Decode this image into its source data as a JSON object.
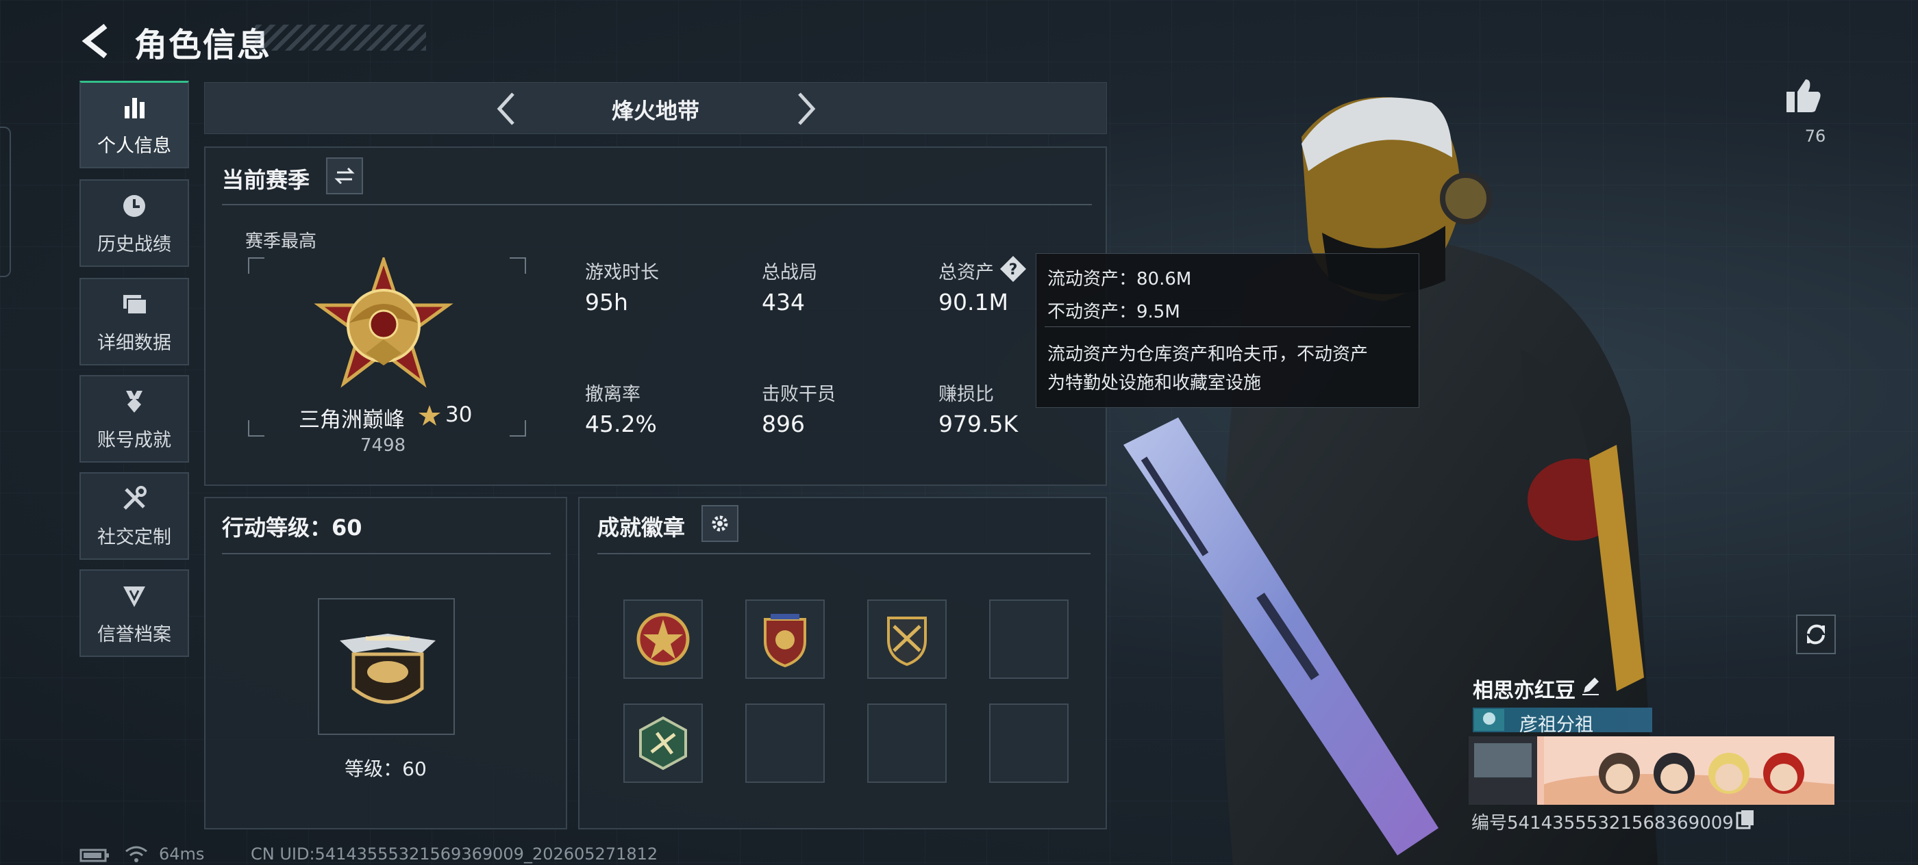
{
  "header": {
    "title": "角色信息"
  },
  "sidebar": {
    "items": [
      {
        "label": "个人信息",
        "icon": "bar-chart-icon",
        "active": true
      },
      {
        "label": "历史战绩",
        "icon": "history-clock-icon",
        "active": false
      },
      {
        "label": "详细数据",
        "icon": "folder-icon",
        "active": false
      },
      {
        "label": "账号成就",
        "icon": "achievement-icon",
        "active": false
      },
      {
        "label": "社交定制",
        "icon": "tools-icon",
        "active": false
      },
      {
        "label": "信誉档案",
        "icon": "shield-icon",
        "active": false
      }
    ]
  },
  "mode_selector": {
    "title": "烽火地带"
  },
  "season": {
    "title": "当前赛季",
    "best_label": "赛季最高",
    "rank_name": "三角洲巅峰",
    "rank_stars": "30",
    "rank_score": "7498",
    "stats": [
      {
        "label": "游戏时长",
        "value": "95h"
      },
      {
        "label": "总战局",
        "value": "434"
      },
      {
        "label": "总资产",
        "value": "90.1M"
      },
      {
        "label": "撤离率",
        "value": "45.2%"
      },
      {
        "label": "击败干员",
        "value": "896"
      },
      {
        "label": "赚损比",
        "value": "979.5K"
      }
    ]
  },
  "tooltip": {
    "line1": "流动资产：80.6M",
    "line2": "不动资产：9.5M",
    "desc1": "流动资产为仓库资产和哈夫币，不动资产",
    "desc2": "为特勤处设施和收藏室设施"
  },
  "action_level": {
    "title": "行动等级：60",
    "level_label": "等级：60"
  },
  "achievements": {
    "title": "成就徽章"
  },
  "player": {
    "name": "相思亦红豆",
    "guild": "彦祖分祖",
    "uid": "编号5414355532156836900​9"
  },
  "likes": {
    "count": "76"
  },
  "status_bar": {
    "ping": "64ms",
    "uid": "CN UID:5414355532156936900​9_202605271812"
  },
  "colors": {
    "accent_green": "#34c08a",
    "gold": "#c9a24a",
    "panel": "#1e272f"
  }
}
